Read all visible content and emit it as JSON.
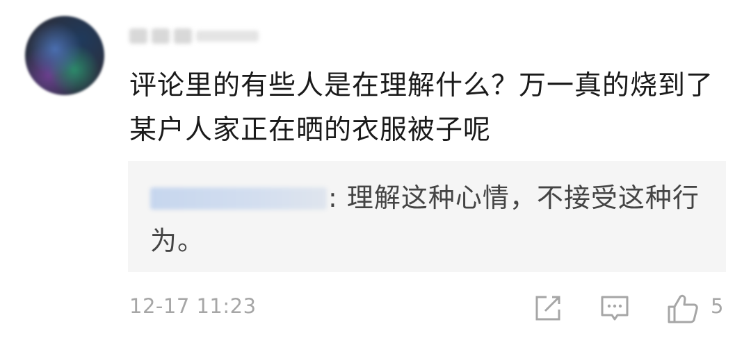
{
  "comment": {
    "text": "评论里的有些人是在理解什么？万一真的烧到了某户人家正在晒的衣服被子呢",
    "reply": {
      "separator": ": ",
      "text": "理解这种心情，不接受这种行为。"
    },
    "timestamp": "12-17 11:23",
    "like_count": "5"
  },
  "icons": {
    "share": "share-icon",
    "reply": "reply-icon",
    "like": "thumbs-up-icon"
  },
  "colors": {
    "text_primary": "#1a1a1a",
    "text_secondary": "#444444",
    "muted": "#a6a6a6",
    "reply_bg": "#f5f5f5"
  }
}
